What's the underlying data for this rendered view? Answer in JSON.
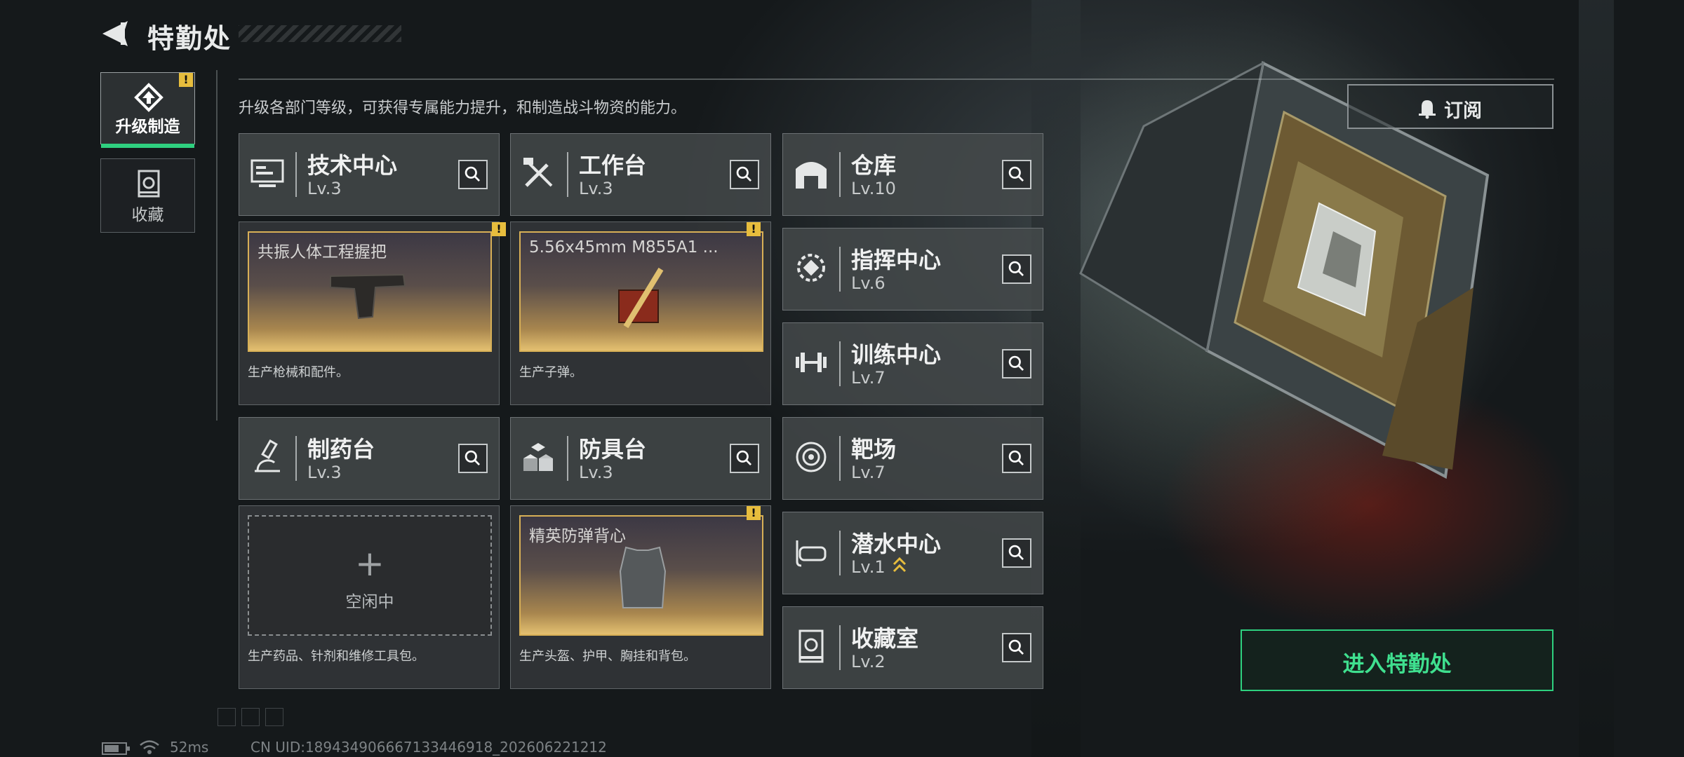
{
  "header": {
    "title": "特勤处"
  },
  "sidebar": {
    "tabs": [
      {
        "label": "升级制造",
        "active": true,
        "alert": "!"
      },
      {
        "label": "收藏",
        "active": false
      }
    ]
  },
  "intro": "升级各部门等级，可获得专属能力提升，和制造战斗物资的能力。",
  "subscribe_label": "订阅",
  "enter_label": "进入特勤处",
  "departments": [
    {
      "name": "技术中心",
      "level": "Lv.3",
      "icon": "tech-center-icon"
    },
    {
      "name": "工作台",
      "level": "Lv.3",
      "icon": "workbench-icon"
    },
    {
      "name": "制药台",
      "level": "Lv.3",
      "icon": "pharmacy-icon"
    },
    {
      "name": "防具台",
      "level": "Lv.3",
      "icon": "armor-bench-icon"
    },
    {
      "name": "仓库",
      "level": "Lv.10",
      "icon": "warehouse-icon"
    },
    {
      "name": "指挥中心",
      "level": "Lv.6",
      "icon": "command-center-icon"
    },
    {
      "name": "训练中心",
      "level": "Lv.7",
      "icon": "training-center-icon"
    },
    {
      "name": "靶场",
      "level": "Lv.7",
      "icon": "shooting-range-icon"
    },
    {
      "name": "潜水中心",
      "level": "Lv.1",
      "icon": "diving-center-icon"
    },
    {
      "name": "收藏室",
      "level": "Lv.2",
      "icon": "collection-room-icon"
    }
  ],
  "production": [
    {
      "item": "共振人体工程握把",
      "desc": "生产枪械和配件。",
      "alert": "!"
    },
    {
      "item": "5.56x45mm M855A1 ...",
      "desc": "生产子弹。",
      "alert": "!"
    },
    {
      "item": "空闲中",
      "desc": "生产药品、针剂和维修工具包。",
      "idle_symbol": "+"
    },
    {
      "item": "精英防弹背心",
      "desc": "生产头盔、护甲、胸挂和背包。",
      "alert": "!"
    }
  ],
  "status": {
    "ping": "52ms",
    "uid": "CN UID:18943490666713344691​8_202606221212"
  },
  "colors": {
    "accent_green": "#2ed07f",
    "alert_yellow": "#e7bd3d"
  }
}
